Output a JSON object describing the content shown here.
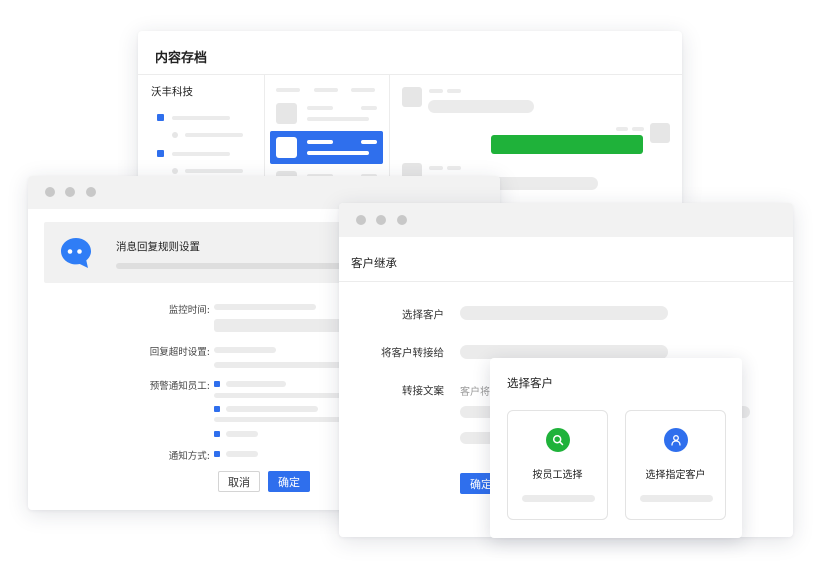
{
  "archive_window": {
    "title": "内容存档",
    "company": "沃丰科技"
  },
  "rules_window": {
    "heading": "消息回复规则设置",
    "fields": {
      "monitor_time": "监控时间:",
      "reply_timeout": "回复超时设置:",
      "alert_staff": "预警通知员工:",
      "notify_method": "通知方式:"
    },
    "cancel_label": "取消",
    "confirm_label": "确定"
  },
  "inherit_window": {
    "title": "客户继承",
    "fields": {
      "select_customer": "选择客户",
      "transfer_to": "将客户转接给",
      "transfer_text": "转接文案"
    },
    "transfer_text_value": "客户将",
    "confirm_label": "确定"
  },
  "select_popup": {
    "title": "选择客户",
    "option_by_staff": "按员工选择",
    "option_specific": "选择指定客户"
  },
  "colors": {
    "primary": "#2f6fed",
    "green": "#1fb23a",
    "chat_icon": "#2f7df6"
  }
}
